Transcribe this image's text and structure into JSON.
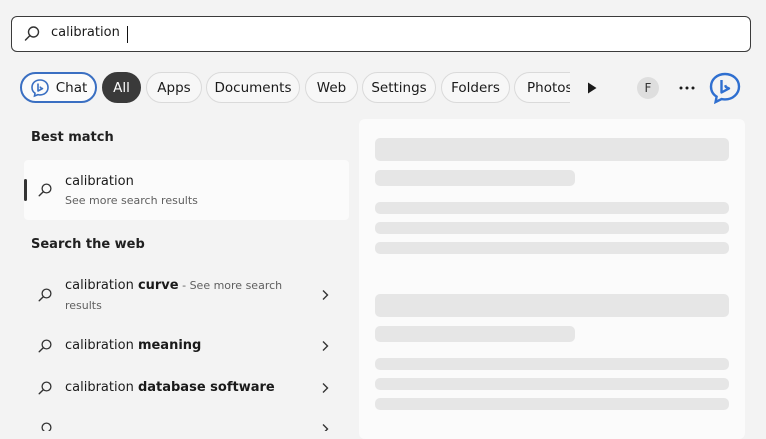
{
  "search": {
    "query": "calibration"
  },
  "filters": {
    "chat_label": "Chat",
    "all_label": "All",
    "apps_label": "Apps",
    "documents_label": "Documents",
    "web_label": "Web",
    "settings_label": "Settings",
    "folders_label": "Folders",
    "photos_label": "Photos",
    "avatar_initial": "F"
  },
  "best_match": {
    "heading": "Best match",
    "title": "calibration",
    "subtitle": "See more search results"
  },
  "web": {
    "heading": "Search the web",
    "items": [
      {
        "prefix": "calibration ",
        "bold": "curve",
        "hint": " - See more search results"
      },
      {
        "prefix": "calibration ",
        "bold": "meaning",
        "hint": ""
      },
      {
        "prefix": "calibration ",
        "bold": "database software",
        "hint": ""
      }
    ]
  },
  "colors": {
    "accent_blue": "#3a6fc2",
    "selected_pill": "#3a3a3a",
    "skeleton": "#e6e6e6"
  },
  "icons": {
    "search": "search-icon",
    "chat": "bing-chat-icon",
    "more": "more-options-icon",
    "scroll": "play-arrow-icon",
    "bing": "bing-icon",
    "chevron": "chevron-right-icon"
  }
}
